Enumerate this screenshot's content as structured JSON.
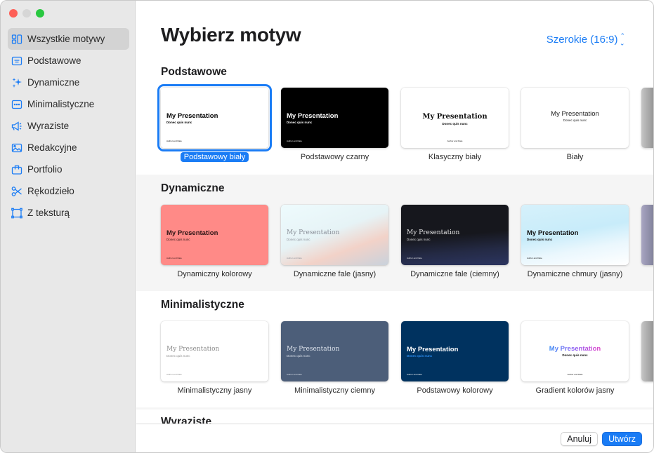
{
  "window": {
    "title": "Wybierz motyw",
    "aspect_selector": "Szerokie (16:9)"
  },
  "sidebar": {
    "items": [
      {
        "label": "Wszystkie motywy",
        "icon": "grid-icon",
        "active": true
      },
      {
        "label": "Podstawowe",
        "icon": "slide-icon"
      },
      {
        "label": "Dynamiczne",
        "icon": "sparkles-icon"
      },
      {
        "label": "Minimalistyczne",
        "icon": "ellipsis-rect-icon"
      },
      {
        "label": "Wyraziste",
        "icon": "megaphone-icon"
      },
      {
        "label": "Redakcyjne",
        "icon": "photo-icon"
      },
      {
        "label": "Portfolio",
        "icon": "briefcase-icon"
      },
      {
        "label": "Rękodzieło",
        "icon": "scissors-icon"
      },
      {
        "label": "Z teksturą",
        "icon": "texture-frame-icon"
      }
    ]
  },
  "thumb_text": {
    "title": "My Presentation",
    "subtitle": "Donec quis nunc",
    "author": "Author and Date"
  },
  "sections": [
    {
      "title": "Podstawowe",
      "themes": [
        {
          "label": "Podstawowy biały",
          "selected": true
        },
        {
          "label": "Podstawowy czarny"
        },
        {
          "label": "Klasyczny biały"
        },
        {
          "label": "Biały"
        }
      ]
    },
    {
      "title": "Dynamiczne",
      "themes": [
        {
          "label": "Dynamiczny kolorowy"
        },
        {
          "label": "Dynamiczne fale (jasny)"
        },
        {
          "label": "Dynamiczne fale (ciemny)"
        },
        {
          "label": "Dynamiczne chmury (jasny)"
        }
      ]
    },
    {
      "title": "Minimalistyczne",
      "themes": [
        {
          "label": "Minimalistyczny jasny"
        },
        {
          "label": "Minimalistyczny ciemny"
        },
        {
          "label": "Podstawowy kolorowy"
        },
        {
          "label": "Gradient kolorów jasny"
        }
      ]
    },
    {
      "title": "Wyraziste",
      "themes": []
    }
  ],
  "footer": {
    "cancel_label": "Anuluj",
    "create_label": "Utwórz"
  },
  "colors": {
    "accent": "#1a7cf5",
    "sidebar_bg": "#e8e8e8",
    "sidebar_active": "#d3d3d3",
    "coral": "#ff8a87",
    "navy": "#00325f",
    "slate": "#4c5e79"
  }
}
